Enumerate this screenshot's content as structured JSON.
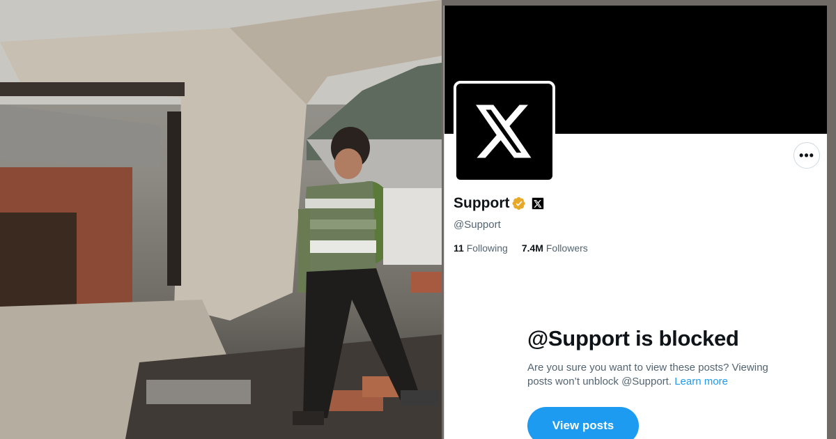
{
  "photo": {
    "description_icon": "photo"
  },
  "profile": {
    "display_name": "Support",
    "handle": "@Support",
    "verified_badge_icon": "verified-gold-badge-icon",
    "affiliate_icon": "x-logo-icon",
    "avatar_icon": "x-logo-icon",
    "more_icon": "more-horizontal-icon",
    "more_label": "•••",
    "following_count": "11",
    "following_label": "Following",
    "followers_count": "7.4M",
    "followers_label": "Followers"
  },
  "blocked": {
    "title": "@Support is blocked",
    "message": "Are you sure you want to view these posts? Viewing posts won’t unblock @Support.",
    "learn_more": "Learn more",
    "view_button": "View posts"
  },
  "colors": {
    "accent": "#1d9bf0",
    "verified": "#e8a92b",
    "text_primary": "#0f1419",
    "text_secondary": "#536471"
  }
}
